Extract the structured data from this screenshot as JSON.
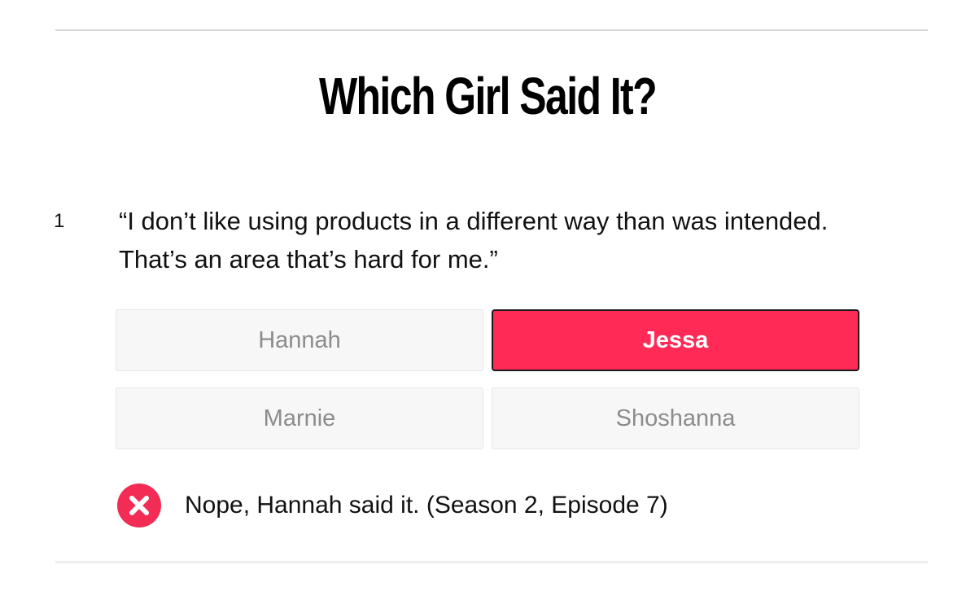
{
  "quiz": {
    "title": "Which Girl Said It?"
  },
  "question": {
    "number": "1",
    "text": "“I don’t like using products in a different way than was intended. That’s an area that’s hard for me.”",
    "answers": [
      {
        "label": "Hannah",
        "selected": false
      },
      {
        "label": "Jessa",
        "selected": true
      },
      {
        "label": "Marnie",
        "selected": false
      },
      {
        "label": "Shoshanna",
        "selected": false
      }
    ],
    "result": {
      "icon": "wrong-x-icon",
      "text": "Nope, Hannah said it. (Season 2, Episode 7)"
    }
  },
  "colors": {
    "accent": "#ff2a55",
    "wrong_icon": "#f22c55",
    "answer_bg": "#f7f7f7",
    "answer_text": "#8c8c8c"
  }
}
